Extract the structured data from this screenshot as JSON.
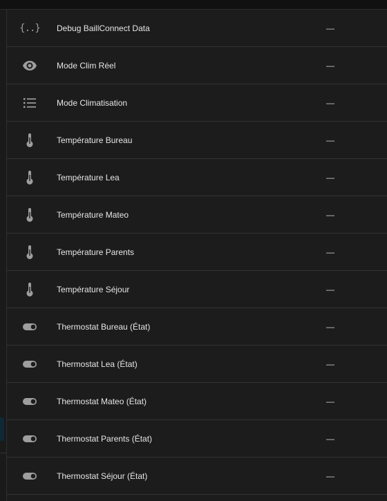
{
  "rows": [
    {
      "name": "Debug BaillConnect Data",
      "icon": "code-braces-icon",
      "state": "—"
    },
    {
      "name": "Mode Clim Réel",
      "icon": "eye-icon",
      "state": "—"
    },
    {
      "name": "Mode Climatisation",
      "icon": "format-list-bulleted-icon",
      "state": "—"
    },
    {
      "name": "Température Bureau",
      "icon": "thermometer-icon",
      "state": "—"
    },
    {
      "name": "Température Lea",
      "icon": "thermometer-icon",
      "state": "—"
    },
    {
      "name": "Température Mateo",
      "icon": "thermometer-icon",
      "state": "—"
    },
    {
      "name": "Température Parents",
      "icon": "thermometer-icon",
      "state": "—"
    },
    {
      "name": "Température Séjour",
      "icon": "thermometer-icon",
      "state": "—"
    },
    {
      "name": "Thermostat Bureau (État)",
      "icon": "toggle-switch-icon",
      "state": "—"
    },
    {
      "name": "Thermostat Lea (État)",
      "icon": "toggle-switch-icon",
      "state": "—"
    },
    {
      "name": "Thermostat Mateo (État)",
      "icon": "toggle-switch-icon",
      "state": "—"
    },
    {
      "name": "Thermostat Parents (État)",
      "icon": "toggle-switch-icon",
      "state": "—"
    },
    {
      "name": "Thermostat Séjour (État)",
      "icon": "toggle-switch-icon",
      "state": "—"
    }
  ],
  "icon_glyphs": {
    "code-braces-icon": "{..}"
  },
  "colors": {
    "background": "#1c1c1c",
    "icon": "#9e9e9e",
    "text": "#e6e6e6",
    "divider": "#333333"
  }
}
